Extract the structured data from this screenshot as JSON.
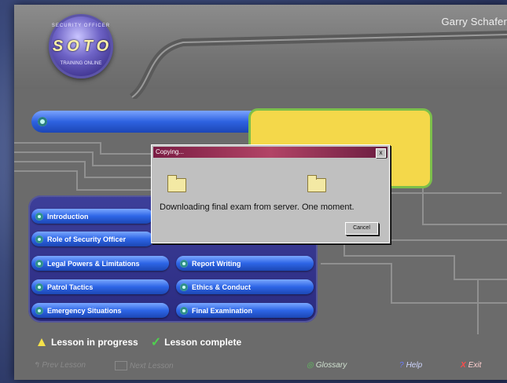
{
  "header": {
    "user_name": "Garry Schafer",
    "logo": {
      "text": "SOTO",
      "top_arc_text": "SECURITY OFFICER",
      "bottom_text": "TRAINING ONLINE"
    }
  },
  "dialog": {
    "title": "Copying...",
    "close_label": "x",
    "message": "Downloading final exam from server. One moment.",
    "cancel_label": "Cancel"
  },
  "lessons": [
    {
      "label": "Introduction"
    },
    {
      "label": "Role of Security Officer"
    },
    {
      "label": "Legal Powers & Limitations"
    },
    {
      "label": "Patrol Tactics"
    },
    {
      "label": "Emergency Situations"
    },
    {
      "label": "Report Writing"
    },
    {
      "label": "Ethics & Conduct"
    },
    {
      "label": "Final Examination"
    }
  ],
  "legend": {
    "in_progress": "Lesson in progress",
    "complete": "Lesson complete"
  },
  "footer": {
    "prev": "Prev Lesson",
    "next": "Next Lesson",
    "glossary": "Glossary",
    "help": "Help",
    "exit": "Exit"
  },
  "colors": {
    "accent_blue": "#2d65e6",
    "panel_yellow": "#f4d84a",
    "dialog_title": "#7a1c43",
    "legend_yellow": "#f5e24a",
    "legend_green": "#4fd04f"
  }
}
